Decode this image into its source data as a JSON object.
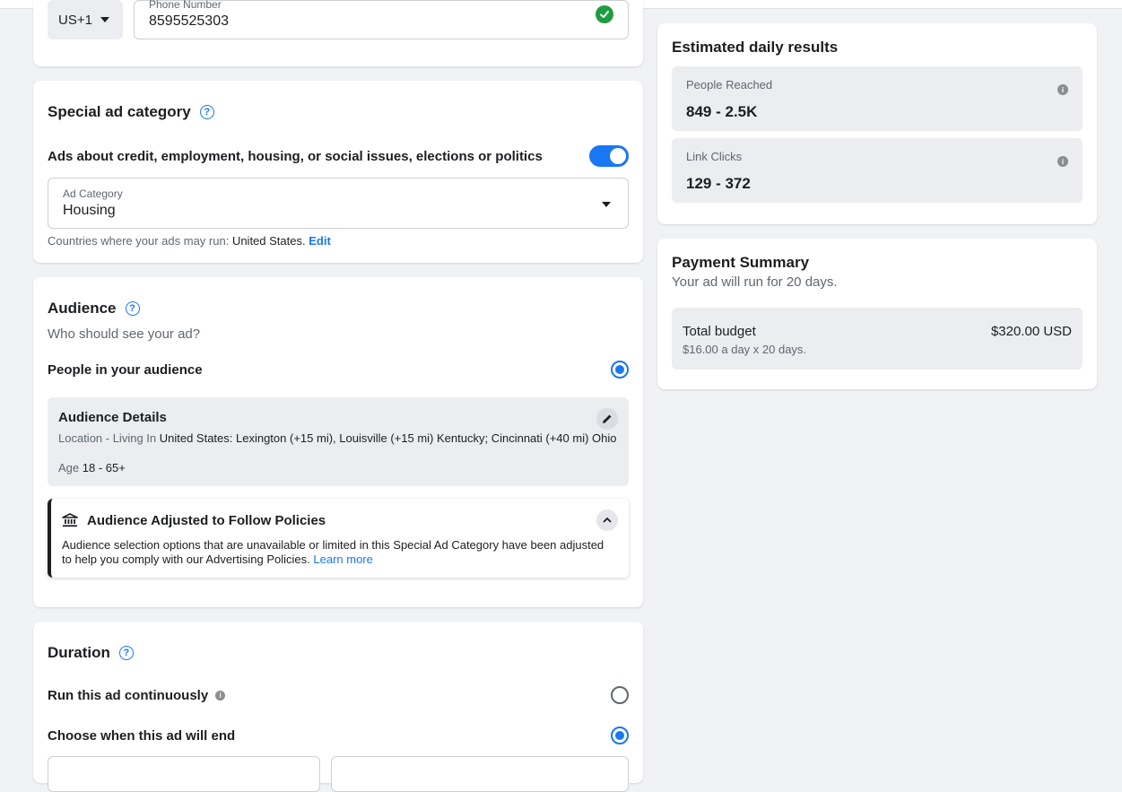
{
  "contact": {
    "country_code": "US+1",
    "phone_label": "Phone Number",
    "phone_value": "8595525303"
  },
  "special_ad_category": {
    "title": "Special ad category",
    "toggle_label": "Ads about credit, employment, housing, or social issues, elections or politics",
    "toggle_on": true,
    "category_label": "Ad Category",
    "category_value": "Housing",
    "countries_prefix": "Countries where your ads may run: ",
    "countries_value": "United States.",
    "edit_link": "Edit"
  },
  "audience": {
    "title": "Audience",
    "subtitle": "Who should see your ad?",
    "option_label": "People in your audience",
    "details": {
      "title": "Audience Details",
      "location_label": "Location - Living In ",
      "location_value": "United States: Lexington (+15 mi), Louisville (+15 mi) Kentucky; Cincinnati (+40 mi) Ohio",
      "age_label": "Age ",
      "age_value": "18 - 65+"
    },
    "policy": {
      "title": "Audience Adjusted to Follow Policies",
      "text": "Audience selection options that are unavailable or limited in this Special Ad Category have been adjusted to help you comply with our Advertising Policies.",
      "learn_more": "Learn more"
    }
  },
  "duration": {
    "title": "Duration",
    "option_continuous": "Run this ad continuously",
    "option_end_date": "Choose when this ad will end",
    "selected": "end_date"
  },
  "estimated": {
    "title": "Estimated daily results",
    "people_reached_label": "People Reached",
    "people_reached_value": "849 - 2.5K",
    "link_clicks_label": "Link Clicks",
    "link_clicks_value": "129 - 372"
  },
  "payment": {
    "title": "Payment Summary",
    "subtitle": "Your ad will run for 20 days.",
    "total_budget_label": "Total budget",
    "total_budget_value": "$320.00 USD",
    "budget_detail": "$16.00 a day x 20 days."
  },
  "colors": {
    "accent": "#1877f2",
    "success": "#1e9c40",
    "background": "#f0f2f5"
  }
}
